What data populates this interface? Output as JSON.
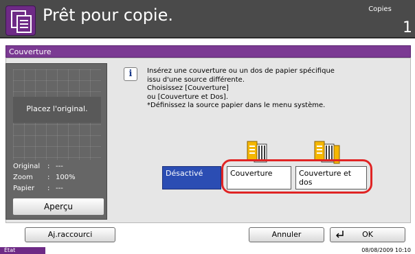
{
  "header": {
    "title": "Prêt pour copie.",
    "copies_label": "Copies",
    "copies_value": "1"
  },
  "screen": {
    "title": "Couverture"
  },
  "preview": {
    "placeholder": "Placez l'original.",
    "rows": [
      {
        "label": "Original",
        "sep": ":",
        "value": "---"
      },
      {
        "label": "Zoom",
        "sep": ":",
        "value": "100%"
      },
      {
        "label": "Papier",
        "sep": ":",
        "value": "---"
      }
    ],
    "apercu_label": "Aperçu"
  },
  "message": {
    "lines": [
      "Insérez une couverture ou un dos de papier spécifique",
      "issu d'une source différente.",
      "Choisissez [Couverture]",
      "ou [Couverture et  Dos].",
      "*Définissez la source papier dans le menu système."
    ]
  },
  "options": {
    "desactive_label": "Désactivé",
    "couverture_label": "Couverture",
    "couverture_dos_line1": "Couverture et",
    "couverture_dos_line2": "dos"
  },
  "footer": {
    "raccourci_label": "Aj.raccourci",
    "annuler_label": "Annuler",
    "ok_label": "OK"
  },
  "status": {
    "etat": "État",
    "datetime": "08/08/2009   10:10"
  },
  "colors": {
    "accent_purple": "#7b3a93",
    "selected_blue": "#2b4db3",
    "highlight_red": "#e02424"
  }
}
